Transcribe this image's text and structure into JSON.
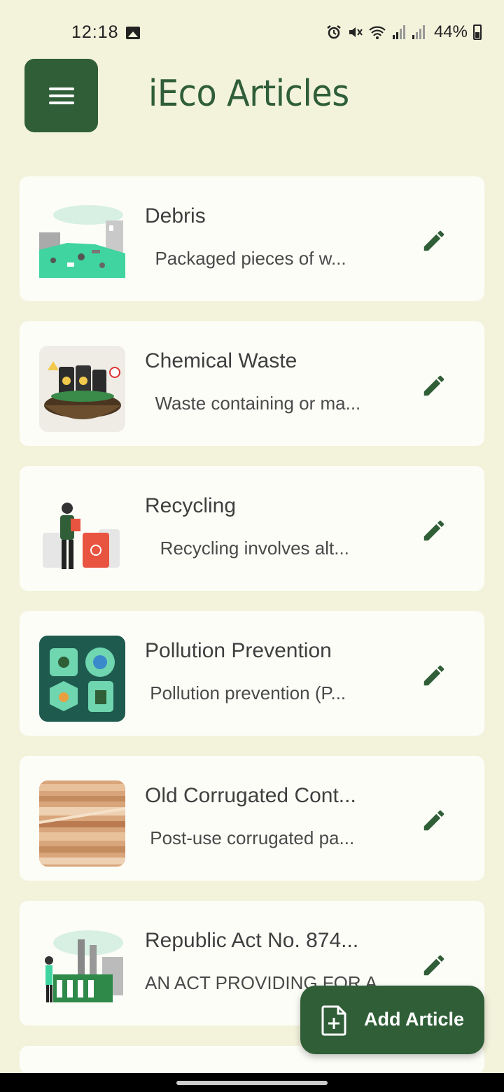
{
  "status_bar": {
    "time": "12:18",
    "battery": "44%",
    "icons": [
      "image-icon",
      "alarm-icon",
      "mute-icon",
      "wifi-icon",
      "signal-icon",
      "signal-icon",
      "battery-icon"
    ]
  },
  "header": {
    "title": "iEco Articles",
    "menu_icon": "hamburger-menu-icon"
  },
  "articles": [
    {
      "title": "Debris",
      "snippet": "  Packaged pieces of w...",
      "thumb": "debris-illustration",
      "edit_icon": "pencil-icon"
    },
    {
      "title": "Chemical Waste",
      "snippet": "  Waste containing or ma...",
      "thumb": "chemical-waste-illustration",
      "edit_icon": "pencil-icon"
    },
    {
      "title": "Recycling",
      "snippet": "   Recycling involves alt...",
      "thumb": "recycling-illustration",
      "edit_icon": "pencil-icon"
    },
    {
      "title": "Pollution Prevention",
      "snippet": " Pollution prevention (P...",
      "thumb": "pollution-prevention-illustration",
      "edit_icon": "pencil-icon"
    },
    {
      "title": "Old Corrugated Cont...",
      "snippet": " Post-use corrugated pa...",
      "thumb": "cardboard-photo",
      "edit_icon": "pencil-icon"
    },
    {
      "title": "Republic Act No. 874...",
      "snippet": "AN ACT PROVIDING FOR A...",
      "thumb": "factory-illustration",
      "edit_icon": "pencil-icon"
    }
  ],
  "fab": {
    "label": "Add Article",
    "icon": "add-document-icon"
  },
  "colors": {
    "background": "#f3f3dc",
    "primary": "#2f5e37",
    "card": "#fdfdf8"
  }
}
